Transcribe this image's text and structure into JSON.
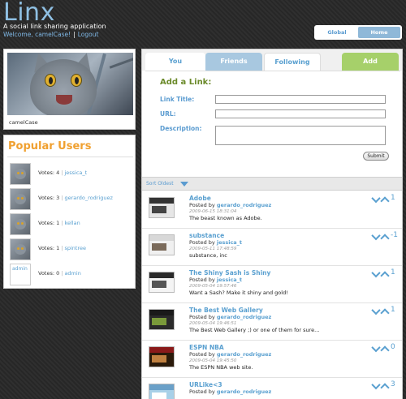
{
  "header": {
    "logo": "Linx",
    "tagline": "A social link sharing application",
    "welcome": "Welcome, camelCase!",
    "logout": "Logout",
    "toggle": [
      "Global",
      "Home"
    ]
  },
  "profile": {
    "username": "camelCase",
    "avatar_icon": "cat-photo-icon"
  },
  "popular": {
    "title": "Popular Users",
    "users": [
      {
        "votes_label": "Votes: 4",
        "name": "jessica_t",
        "thumb": "cat"
      },
      {
        "votes_label": "Votes: 3",
        "name": "gerardo_rodriguez",
        "thumb": "cat"
      },
      {
        "votes_label": "Votes: 1",
        "name": "kellan",
        "thumb": "cat"
      },
      {
        "votes_label": "Votes: 1",
        "name": "spintree",
        "thumb": "cat"
      },
      {
        "votes_label": "Votes: 0",
        "name": "admin",
        "thumb": "text",
        "thumb_text": "admin"
      }
    ]
  },
  "tabs": {
    "you": "You",
    "friends": "Friends",
    "following": "Following",
    "add": "Add"
  },
  "add_form": {
    "title": "Add a Link:",
    "link_title_label": "Link Title:",
    "url_label": "URL:",
    "description_label": "Description:",
    "link_title_value": "",
    "url_value": "",
    "description_value": "",
    "submit": "Submit"
  },
  "sort": {
    "label": "Sort Oldest"
  },
  "links": [
    {
      "title": "Adobe",
      "by_prefix": "Posted by",
      "by": "gerardo_rodriguez",
      "time": "2009-06-15 18:31:04",
      "desc": "The beast known as Adobe.",
      "votes": "1",
      "thumb_top": "#333333",
      "thumb_bg": "#e6e6e6",
      "thumb_mid": "#444444"
    },
    {
      "title": "substance",
      "by_prefix": "Posted by",
      "by": "jessica_t",
      "time": "2009-05-11 17:48:59",
      "desc": "substance, inc",
      "votes": "-1",
      "thumb_top": "#d8d8d8",
      "thumb_bg": "#f0f0f0",
      "thumb_mid": "#7a6a5a"
    },
    {
      "title": "The Shiny Sash is Shiny",
      "by_prefix": "Posted by",
      "by": "jessica_t",
      "time": "2009-05-04 19:57:46",
      "desc": "Want a Sash? Make it shiny and gold!",
      "votes": "1",
      "thumb_top": "#2a2a2a",
      "thumb_bg": "#f4f4f4",
      "thumb_mid": "#555555"
    },
    {
      "title": "The Best Web Gallery",
      "by_prefix": "Posted by",
      "by": "gerardo_rodriguez",
      "time": "2009-05-04 19:46:51",
      "desc": "The Best Web Gallery ;) or one of them for sure...",
      "votes": "1",
      "thumb_top": "#1a1a1a",
      "thumb_bg": "#2a2a2a",
      "thumb_mid": "#7a9a3a"
    },
    {
      "title": "ESPN NBA",
      "by_prefix": "Posted by",
      "by": "gerardo_rodriguez",
      "time": "2009-05-04 19:45:50",
      "desc": "The ESPN NBA web site.",
      "votes": "0",
      "thumb_top": "#8a1a1a",
      "thumb_bg": "#2a1a0a",
      "thumb_mid": "#c08040"
    },
    {
      "title": "URLike<3",
      "by_prefix": "Posted by",
      "by": "gerardo_rodriguez",
      "time": "",
      "desc": "",
      "votes": "3",
      "thumb_top": "#6aa0c8",
      "thumb_bg": "#a8d0e8",
      "thumb_mid": "#ffffff"
    }
  ]
}
